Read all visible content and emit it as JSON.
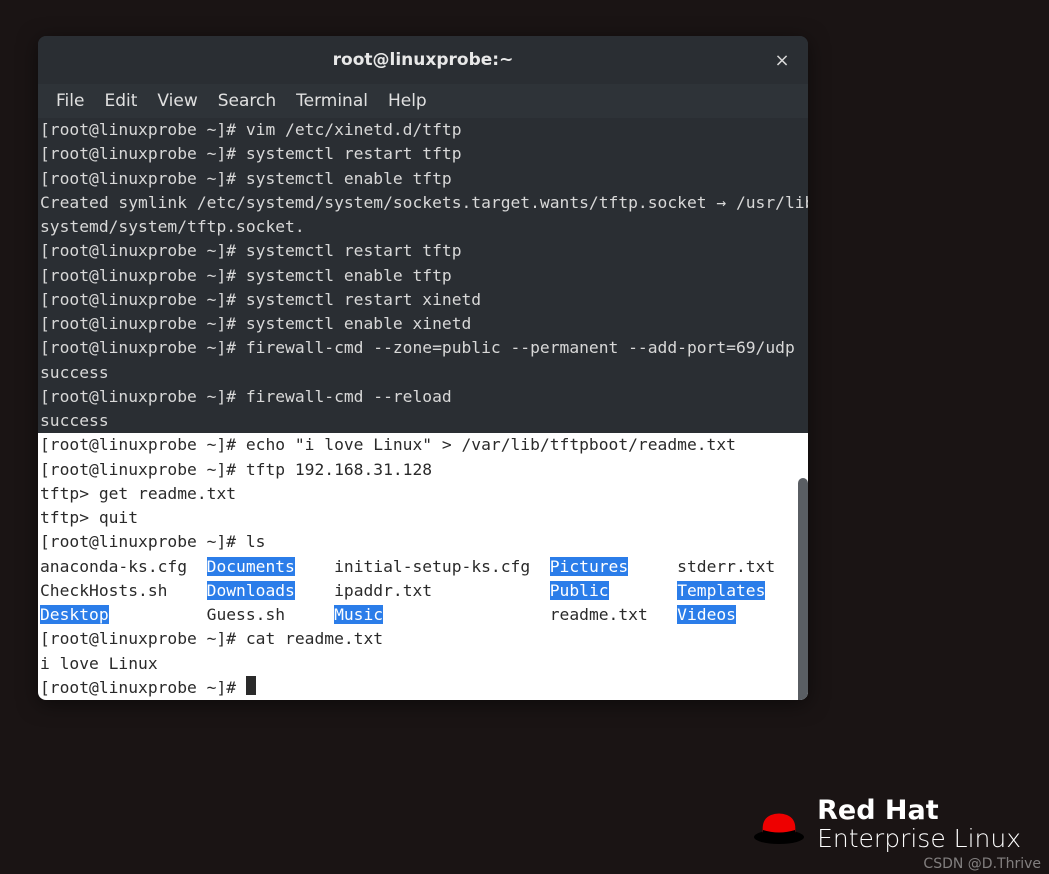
{
  "window": {
    "title": "root@linuxprobe:~",
    "close_symbol": "×"
  },
  "menubar": {
    "items": [
      "File",
      "Edit",
      "View",
      "Search",
      "Terminal",
      "Help"
    ]
  },
  "terminal": {
    "prompt": "[root@linuxprobe ~]# ",
    "dark_lines": [
      {
        "t": "prompt_cmd",
        "cmd": "vim /etc/xinetd.d/tftp"
      },
      {
        "t": "prompt_cmd",
        "cmd": "systemctl restart tftp"
      },
      {
        "t": "prompt_cmd",
        "cmd": "systemctl enable tftp"
      },
      {
        "t": "output",
        "text": "Created symlink /etc/systemd/system/sockets.target.wants/tftp.socket → /usr/lib/"
      },
      {
        "t": "output",
        "text": "systemd/system/tftp.socket."
      },
      {
        "t": "prompt_cmd",
        "cmd": "systemctl restart tftp"
      },
      {
        "t": "prompt_cmd",
        "cmd": "systemctl enable tftp"
      },
      {
        "t": "prompt_cmd",
        "cmd": "systemctl restart xinetd"
      },
      {
        "t": "prompt_cmd",
        "cmd": "systemctl enable xinetd"
      },
      {
        "t": "prompt_cmd",
        "cmd": "firewall-cmd --zone=public --permanent --add-port=69/udp"
      },
      {
        "t": "output",
        "text": "success"
      },
      {
        "t": "prompt_cmd",
        "cmd": "firewall-cmd --reload"
      },
      {
        "t": "output",
        "text": "success"
      }
    ],
    "light_section": {
      "cmds": [
        {
          "t": "prompt_cmd",
          "cmd": "echo \"i love Linux\" > /var/lib/tftpboot/readme.txt"
        },
        {
          "t": "prompt_cmd",
          "cmd": "tftp 192.168.31.128"
        },
        {
          "t": "output",
          "text": "tftp> get readme.txt"
        },
        {
          "t": "output",
          "text": "tftp> quit"
        },
        {
          "t": "prompt_cmd",
          "cmd": "ls"
        }
      ],
      "ls_output": {
        "row1": [
          {
            "n": "anaconda-ks.cfg",
            "d": false
          },
          {
            "n": "Documents",
            "d": true
          },
          {
            "n": "initial-setup-ks.cfg",
            "d": false
          },
          {
            "n": "Pictures",
            "d": true
          },
          {
            "n": "stderr.txt",
            "d": false
          }
        ],
        "row2": [
          {
            "n": "CheckHosts.sh",
            "d": false
          },
          {
            "n": "Downloads",
            "d": true
          },
          {
            "n": "ipaddr.txt",
            "d": false
          },
          {
            "n": "Public",
            "d": true
          },
          {
            "n": "Templates",
            "d": true
          }
        ],
        "row3": [
          {
            "n": "Desktop",
            "d": true
          },
          {
            "n": "Guess.sh",
            "d": false
          },
          {
            "n": "Music",
            "d": true
          },
          {
            "n": "readme.txt",
            "d": false
          },
          {
            "n": "Videos",
            "d": true
          }
        ]
      },
      "after_ls": [
        {
          "t": "prompt_cmd",
          "cmd": "cat readme.txt"
        },
        {
          "t": "output",
          "text": "i love Linux"
        },
        {
          "t": "prompt_cursor"
        }
      ]
    }
  },
  "logo": {
    "line1": "Red Hat",
    "line2": "Enterprise Linux"
  },
  "watermark": "CSDN @D.Thrive"
}
